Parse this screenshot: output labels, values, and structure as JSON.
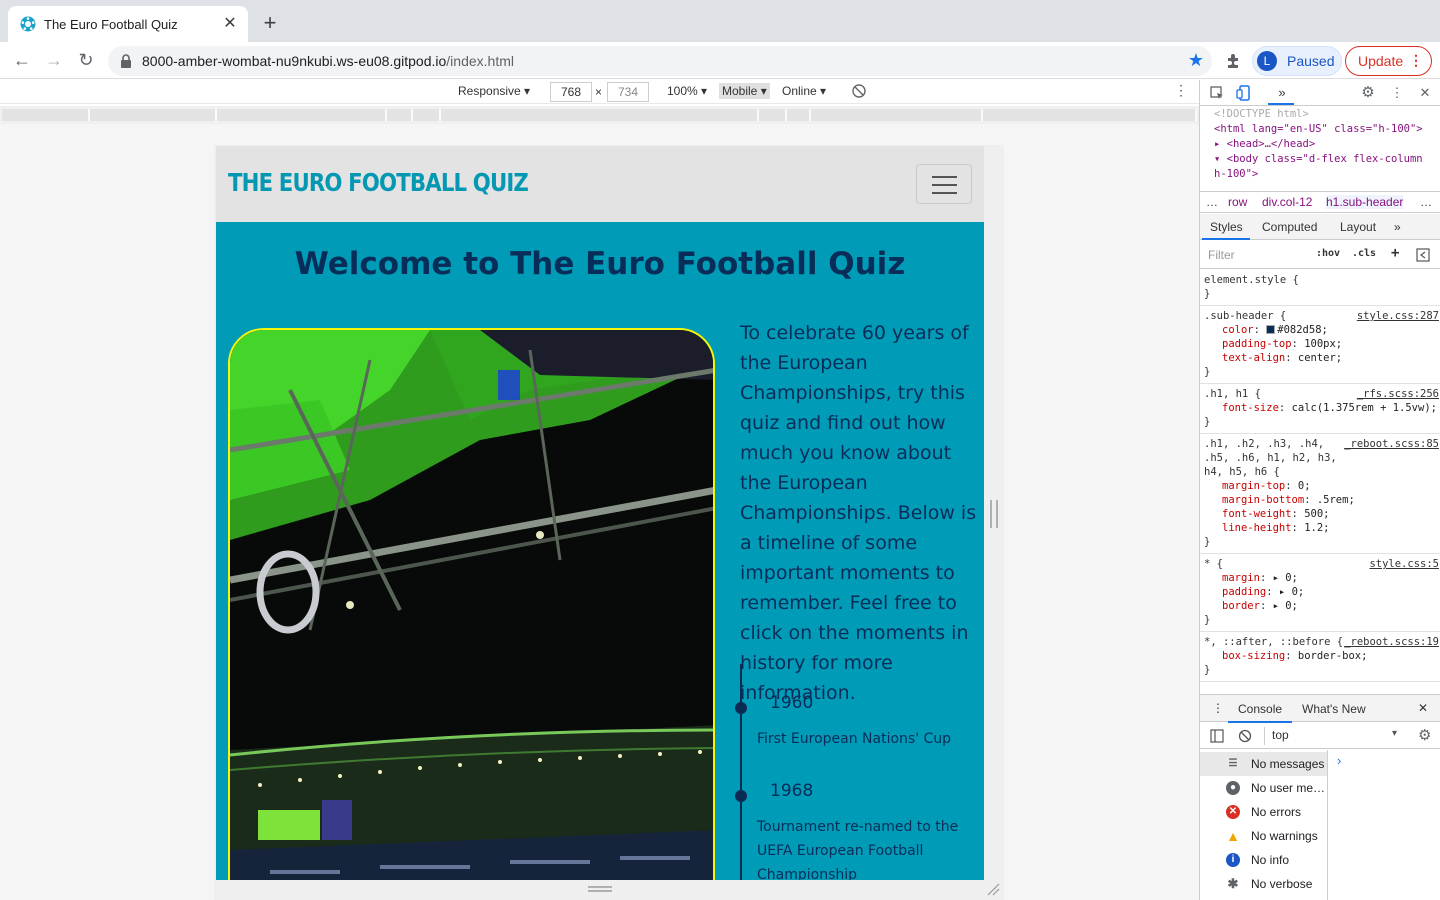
{
  "browser": {
    "tab_title": "The Euro Football Quiz",
    "url_host": "8000-amber-wombat-nu9nkubi.ws-eu08.gitpod.io",
    "url_path": "/index.html",
    "profile_initial": "L",
    "profile_status": "Paused",
    "update_label": "Update"
  },
  "device_toolbar": {
    "mode": "Responsive",
    "width": "768",
    "height": "734",
    "zoom": "100%",
    "throttle_profile": "Mobile",
    "network": "Online"
  },
  "site": {
    "brand": "THE EURO FOOTBALL QUIZ",
    "heading": "Welcome to The Euro Football Quiz",
    "intro": "To celebrate 60 years of the European Championships, try this quiz and find out how much you know about the European Championships. Below is a timeline of some important moments to remember. Feel free to click on the moments in history for more information.",
    "timeline": [
      {
        "year": "1960",
        "text": "First European Nations' Cup"
      },
      {
        "year": "1968",
        "text": "Tournament re-named to the UEFA European Football Championship"
      }
    ],
    "colors": {
      "background": "#009bb7",
      "heading": "#082d58",
      "brand": "#0598b3",
      "image_border": "#f6f60c"
    }
  },
  "devtools": {
    "elements": [
      "<!DOCTYPE html>",
      "<html lang=\"en-US\" class=\"h-100\">",
      "<head>…</head>",
      "<body class=\"d-flex flex-column h-100\">"
    ],
    "breadcrumbs": [
      "…",
      "row",
      "div.col-12",
      "h1.sub-header",
      "…"
    ],
    "panel_tabs": [
      "Styles",
      "Computed",
      "Layout",
      "»"
    ],
    "filter_placeholder": "Filter",
    "hov": ":hov",
    "cls": ".cls",
    "rules": [
      {
        "selector": "element.style {",
        "source": "",
        "props": []
      },
      {
        "selector": ".sub-header {",
        "source": "style.css:287",
        "props": [
          [
            "color",
            "#082d58;"
          ],
          [
            "padding-top",
            "100px;"
          ],
          [
            "text-align",
            "center;"
          ]
        ]
      },
      {
        "selector": ".h1, h1 {",
        "source": "_rfs.scss:256",
        "props": [
          [
            "font-size",
            "calc(1.375rem + 1.5vw);"
          ]
        ]
      },
      {
        "selector": ".h1, .h2, .h3, .h4, .h5, .h6, h1, h2, h3, h4, h5, h6 {",
        "source": "_reboot.scss:85",
        "props": [
          [
            "margin-top",
            "0;"
          ],
          [
            "margin-bottom",
            ".5rem;"
          ],
          [
            "font-weight",
            "500;"
          ],
          [
            "line-height",
            "1.2;"
          ]
        ]
      },
      {
        "selector": "* {",
        "source": "style.css:5",
        "props": [
          [
            "margin",
            "▸ 0;"
          ],
          [
            "padding",
            "▸ 0;"
          ],
          [
            "border",
            "▸ 0;"
          ]
        ]
      },
      {
        "selector": "*, ::after, ::before {",
        "source": "_reboot.scss:19",
        "props": [
          [
            "box-sizing",
            "border-box;"
          ]
        ]
      }
    ],
    "console_tabs": [
      "Console",
      "What's New"
    ],
    "context": "top",
    "messages": [
      {
        "label": "No messages",
        "icon": "list-icon"
      },
      {
        "label": "No user me…",
        "icon": "user-icon"
      },
      {
        "label": "No errors",
        "icon": "error-icon"
      },
      {
        "label": "No warnings",
        "icon": "warning-icon"
      },
      {
        "label": "No info",
        "icon": "info-icon"
      },
      {
        "label": "No verbose",
        "icon": "verbose-icon"
      }
    ]
  }
}
